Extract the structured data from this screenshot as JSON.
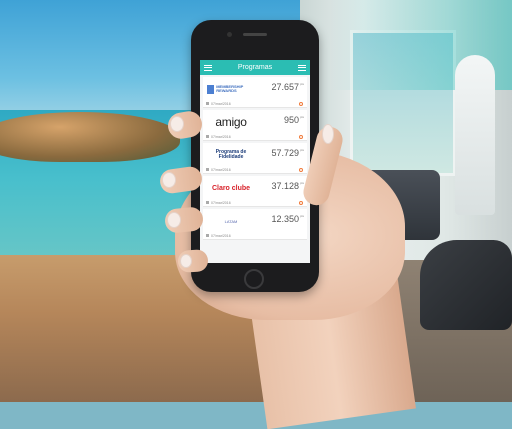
{
  "app": {
    "title": "Programas"
  },
  "programs": [
    {
      "logo": "MEMBERSHIP REWARDS",
      "points": "27.657",
      "unit": "pts",
      "date": "07/mar/2016"
    },
    {
      "logo": "amigo",
      "points": "950",
      "unit": "pts",
      "date": "07/mar/2016"
    },
    {
      "logo": "Programa de Fidelidade",
      "points": "57.729",
      "unit": "pts",
      "date": "07/mar/2016"
    },
    {
      "logo": "Claro clube",
      "points": "37.128",
      "unit": "pts",
      "date": "07/mar/2016"
    },
    {
      "logo": "LATAM",
      "points": "12.350",
      "unit": "pts",
      "date": "07/mar/2016"
    }
  ],
  "fab": {
    "label": "+"
  },
  "colors": {
    "appbar": "#2bbdb3",
    "fab": "#f0522a",
    "accent": "#f07a3a"
  }
}
